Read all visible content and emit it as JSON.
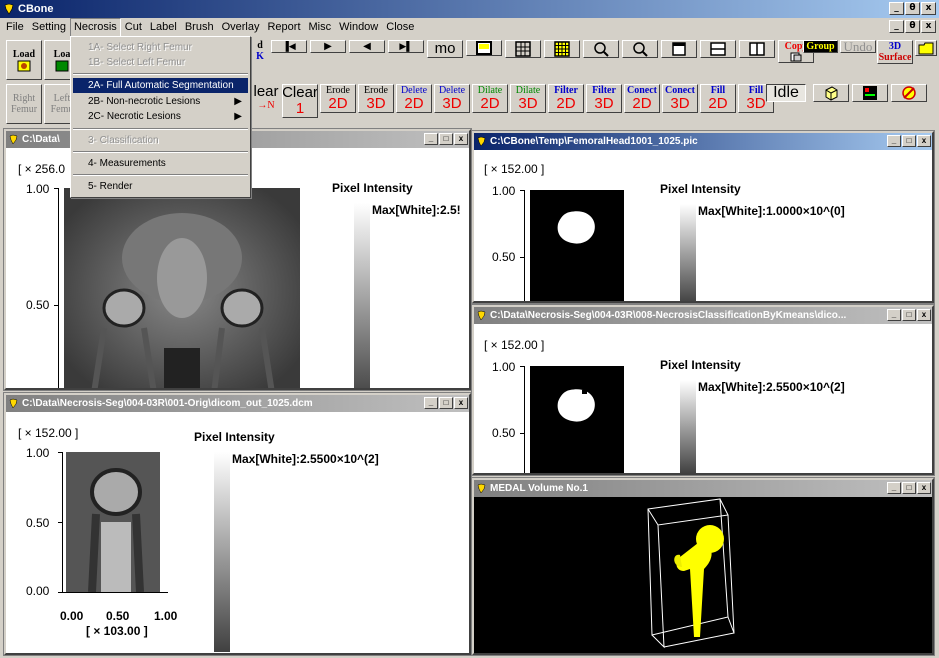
{
  "app": {
    "title": "CBone"
  },
  "caption_buttons": [
    "_",
    "θ",
    "x"
  ],
  "menubar": {
    "items": [
      "File",
      "Setting",
      "Necrosis",
      "Cut",
      "Label",
      "Brush",
      "Overlay",
      "Report",
      "Misc",
      "Window",
      "Close"
    ]
  },
  "mdi_buttons": [
    "_",
    "θ",
    "x"
  ],
  "toolbar1": {
    "load_btn": "Load",
    "load2_btn": "Loa",
    "partial_btn": "d",
    "partial_btn2": "K",
    "first_btn": "▐◀",
    "prev_btn": "▶",
    "back_btn": "◀",
    "last_btn": "▶▌",
    "mo_btn": "mo",
    "copy_btn": "Copy",
    "group_btn": "Group",
    "undo_btn": "Undo",
    "surface_btn_top": "3D",
    "surface_btn_bottom": "Surface"
  },
  "toolbar2": {
    "right_femur": [
      "Right",
      "Femur"
    ],
    "left_femur": [
      "Left",
      "Femu"
    ],
    "clear_n": [
      "lear",
      "→N"
    ],
    "clear_1": [
      "Clear",
      "1"
    ],
    "erode2d": [
      "Erode",
      "2D"
    ],
    "erode3d": [
      "Erode",
      "3D"
    ],
    "delete2d": [
      "Delete",
      "2D"
    ],
    "delete3d": [
      "Delete",
      "3D"
    ],
    "dilate2d": [
      "Dilate",
      "2D"
    ],
    "dilate3d": [
      "Dilate",
      "3D"
    ],
    "filter2d": [
      "Filter",
      "2D"
    ],
    "filter3d": [
      "Filter",
      "3D"
    ],
    "conect2d": [
      "Conect",
      "2D"
    ],
    "conect3d": [
      "Conect",
      "3D"
    ],
    "fill2d": [
      "Fill",
      "2D"
    ],
    "fill3d": [
      "Fill",
      "3D"
    ],
    "idle": "Idle"
  },
  "dropdown": {
    "items": [
      {
        "label": "1A- Select Right Femur",
        "disabled": true
      },
      {
        "label": "1B- Select Left Femur",
        "disabled": true
      },
      {
        "label": "2A- Full Automatic Segmentation",
        "disabled": false,
        "highlighted": true
      },
      {
        "label": "2B- Non-necrotic Lesions",
        "disabled": false,
        "submenu": true
      },
      {
        "label": "2C- Necrotic Lesions",
        "disabled": false,
        "submenu": true
      },
      {
        "label": "3- Classification",
        "disabled": true
      },
      {
        "label": "4- Measurements",
        "disabled": false
      },
      {
        "label": "5- Render",
        "disabled": false
      }
    ]
  },
  "win_main": {
    "title": "C:\\Data\\",
    "scale": "[ × 256.0",
    "y_top": "1.00",
    "y_mid": "0.50",
    "intensity_label": "Pixel Intensity",
    "max_label": "Max[White]:2.5!"
  },
  "win_femoral": {
    "title": "C:\\CBone\\Temp\\FemoralHead1001_1025.pic",
    "scale": "[ × 152.00 ]",
    "y_top": "1.00",
    "y_mid": "0.50",
    "intensity_label": "Pixel Intensity",
    "max_label": "Max[White]:1.0000×10^(0]"
  },
  "win_kmeans": {
    "title": "C:\\Data\\Necrosis-Seg\\004-03R\\008-NecrosisClassificationByKmeans\\dico...",
    "scale": "[ × 152.00 ]",
    "y_top": "1.00",
    "y_mid": "0.50",
    "intensity_label": "Pixel Intensity",
    "max_label": "Max[White]:2.5500×10^(2]"
  },
  "win_orig": {
    "title": "C:\\Data\\Necrosis-Seg\\004-03R\\001-Orig\\dicom_out_1025.dcm",
    "scale": "[ × 152.00 ]",
    "y_top": "1.00",
    "y_mid": "0.50",
    "y_bot": "0.00",
    "x_ticks": [
      "0.00",
      "0.50",
      "1.00"
    ],
    "x_scale": "[ × 103.00 ]",
    "intensity_label": "Pixel Intensity",
    "max_label": "Max[White]:2.5500×10^(2]"
  },
  "win_volume": {
    "title": "MEDAL Volume No.1"
  }
}
